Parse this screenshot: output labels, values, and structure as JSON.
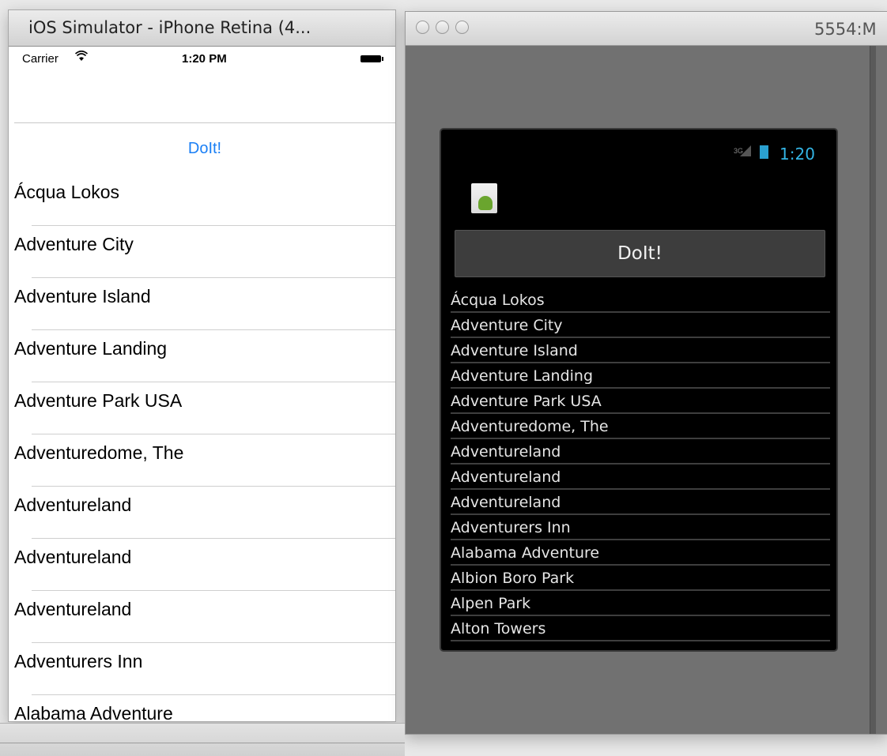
{
  "ios": {
    "window_title": "iOS Simulator - iPhone Retina (4...",
    "status": {
      "carrier": "Carrier",
      "wifi_icon": "wifi-icon",
      "time": "1:20 PM",
      "battery_icon": "battery-icon"
    },
    "doit_label": "DoIt!",
    "items": [
      "Ácqua Lokos",
      "Adventure City",
      "Adventure Island",
      "Adventure Landing",
      "Adventure Park USA",
      "Adventuredome, The",
      "Adventureland",
      "Adventureland",
      "Adventureland",
      "Adventurers Inn",
      "Alabama Adventure"
    ]
  },
  "android": {
    "window_title": "5554:M",
    "status": {
      "network": "3G",
      "time": "1:20"
    },
    "doit_label": "DoIt!",
    "items": [
      "Ácqua Lokos",
      "Adventure City",
      "Adventure Island",
      "Adventure Landing",
      "Adventure Park USA",
      "Adventuredome, The",
      "Adventureland",
      "Adventureland",
      "Adventureland",
      "Adventurers Inn",
      "Alabama Adventure",
      "Albion Boro Park",
      "Alpen Park",
      "Alton Towers"
    ]
  }
}
